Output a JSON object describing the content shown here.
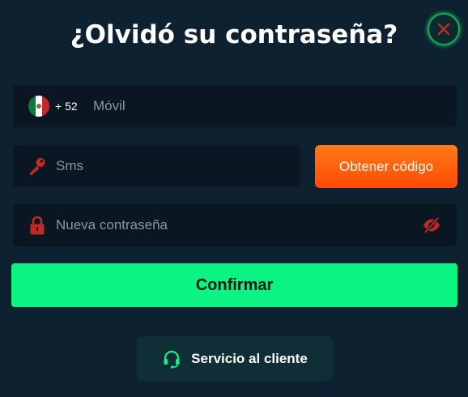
{
  "dialog": {
    "title": "¿Olvidó su contraseña?",
    "close_icon": "close-icon"
  },
  "phone": {
    "country_flag": "mexico-flag-icon",
    "country_code": "+ 52",
    "placeholder": "Móvil"
  },
  "sms": {
    "icon": "key-icon",
    "placeholder": "Sms",
    "button_label": "Obtener código"
  },
  "password": {
    "icon": "lock-icon",
    "placeholder": "Nueva contraseña",
    "visibility_icon": "eye-off-icon"
  },
  "confirm_label": "Confirmar",
  "support": {
    "icon": "headset-icon",
    "label": "Servicio al cliente"
  },
  "colors": {
    "background": "#0d2130",
    "field_bg": "#0a1622",
    "accent_green": "#0af383",
    "orange": "#ff6a10",
    "icon_red": "#c12a22"
  }
}
